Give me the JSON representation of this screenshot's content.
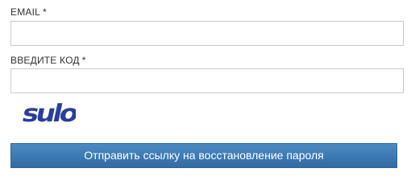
{
  "form": {
    "email": {
      "label": "EMAIL",
      "required_marker": "*",
      "value": ""
    },
    "code": {
      "label": "ВВЕДИТЕ КОД",
      "required_marker": "*",
      "value": ""
    },
    "captcha": {
      "text": "sulo",
      "color": "#2a3f9c"
    },
    "submit_label": "Отправить ссылку на восстановление пароля",
    "accent_color": "#3d79b3"
  }
}
